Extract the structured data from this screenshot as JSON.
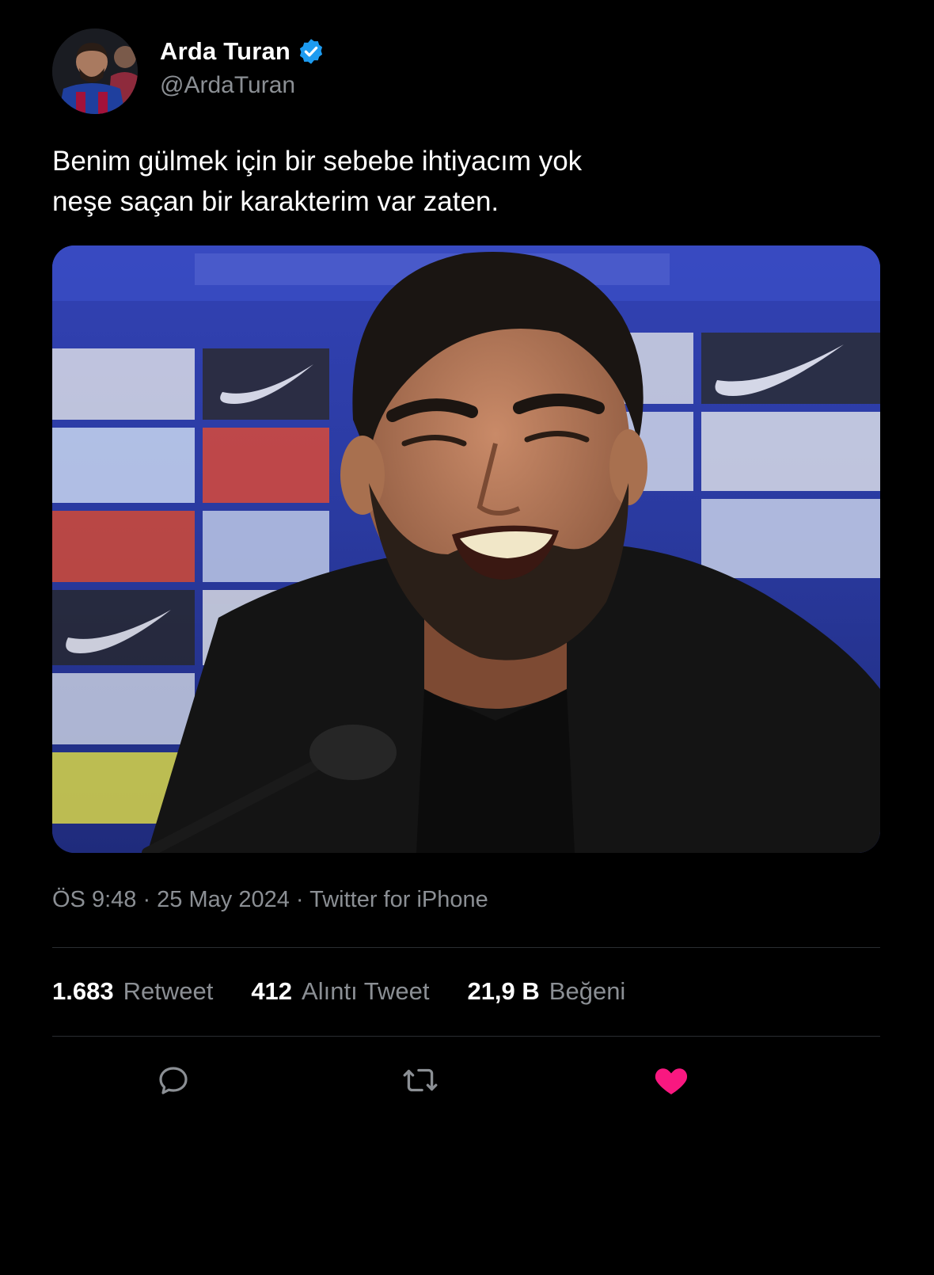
{
  "user": {
    "display_name": "Arda Turan",
    "handle": "@ArdaTuran",
    "verified": true,
    "verified_color": "#1d9bf0"
  },
  "tweet": {
    "text": "Benim gülmek için bir sebebe ihtiyacım yok\nneşe saçan bir karakterim var zaten.",
    "meta": "ÖS 9:48 · 25 May 2024 · Twitter for iPhone"
  },
  "stats": [
    {
      "count": "1.683",
      "label": "Retweet"
    },
    {
      "count": "412",
      "label": "Alıntı Tweet"
    },
    {
      "count": "21,9 B",
      "label": "Beğeni"
    }
  ],
  "actions": {
    "reply_icon": "reply-icon",
    "retweet_icon": "retweet-icon",
    "like_icon": "heart-icon",
    "liked": true,
    "like_color": "#f91880"
  }
}
